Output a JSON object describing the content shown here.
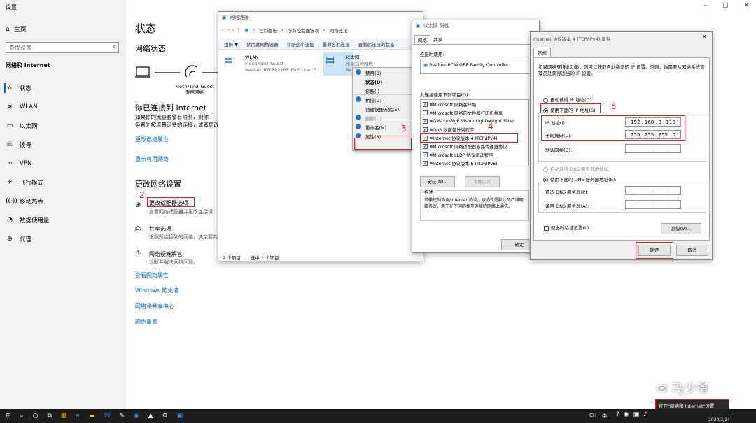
{
  "settings": {
    "title": "设置",
    "home": "主页",
    "search_placeholder": "查找设置",
    "section": "网络和 Internet",
    "nav": [
      {
        "icon": "⌂",
        "label": "状态"
      },
      {
        "icon": "≋",
        "label": "WLAN"
      },
      {
        "icon": "▭",
        "label": "以太网"
      },
      {
        "icon": "☏",
        "label": "拨号"
      },
      {
        "icon": "∞",
        "label": "VPN"
      },
      {
        "icon": "✈",
        "label": "飞行模式"
      },
      {
        "icon": "((·))",
        "label": "移动热点"
      },
      {
        "icon": "◔",
        "label": "数据使用量"
      },
      {
        "icon": "⊕",
        "label": "代理"
      }
    ],
    "page_title": "状态",
    "network_status": "网络状态",
    "network_name": "MechMind_Guest",
    "network_type": "专用网络",
    "connected_title": "你已连接到 Internet",
    "connected_desc1": "如果你的流量套餐有限制，则你",
    "connected_desc2": "务置为按流量计费的连接，或者更改其他属性。",
    "change_props": "更改连接属性",
    "show_networks": "显示可用网络",
    "change_settings": "更改网络设置",
    "adapter_opts": "更改适配器选项",
    "adapter_desc": "查看网络适配器并更改连接设",
    "sharing": "共享选项",
    "sharing_desc": "根据所连接到的网络，决定要共",
    "troubleshoot": "网络疑难解答",
    "troubleshoot_desc": "诊断并解决网络问题。",
    "link1": "查看网络属性",
    "link2": "Windows 防火墙",
    "link3": "网络和共享中心",
    "link4": "网络重置"
  },
  "netconn": {
    "title": "网络连接",
    "addr": [
      "控制面板",
      "所有控制面板项",
      "网络连接"
    ],
    "toolbar": [
      "组织 ▼",
      "禁用此网络设备",
      "诊断这个连接",
      "重命名此连接",
      "查看此连接的状态"
    ],
    "wlan_name": "WLAN",
    "wlan_net": "MechMind_Guest",
    "wlan_adapter": "Realtek RTL8822BE 802.11ac P...",
    "eth_name": "以太网",
    "eth_status": "未识别的网络",
    "eth_short": "Re",
    "status": "2 个项目",
    "selected": "选中 1 个项目"
  },
  "context": [
    "禁用(B)",
    "状态(U)",
    "诊断(I)",
    "桥接(G)",
    "创建快捷方式(S)",
    "删除(D)",
    "重命名(M)",
    "属性(R)"
  ],
  "ethprops": {
    "title": "以太网 属性",
    "tabs": [
      "网络",
      "共享"
    ],
    "connect_using": "连接时使用:",
    "adapter": "Realtek PCIe GBE Family Controller",
    "items_label": "此连接使用下列项目(O):",
    "items": [
      "Microsoft 网络客户端",
      "Microsoft 网络的文件和打印机共享",
      "Galaxy GigE Vision LightWeight Filter",
      "QoS 数据包计划程序",
      "Internet 协议版本 4 (TCP/IPv4)",
      "Microsoft 网络适配器多路传送器协议",
      "Microsoft LLDP 协议驱动程序",
      "Internet 协议版本 6 (TCP/IPv6)"
    ],
    "install": "安装(N)...",
    "uninstall": "卸载(U)",
    "desc_label": "描述",
    "desc": "传输控制协议/Internet 协议。该协议是默认的广域网络协议，用于在不同的相互连接的网络上通信。",
    "ok": "确定"
  },
  "ipv4": {
    "title": "Internet 协议版本 4 (TCP/IPv4) 属性",
    "tab": "常规",
    "intro": "如果网络支持此功能，则可以获取自动指派的 IP 设置。否则，你需要从网络系统管理员处获得适当的 IP 设置。",
    "auto_ip": "自动获得 IP 地址(O)",
    "manual_ip": "使用下面的 IP 地址(S):",
    "ip_label": "IP 地址(I):",
    "ip": [
      "192",
      "168",
      "3",
      "110"
    ],
    "mask_label": "子网掩码(U):",
    "mask": [
      "255",
      "255",
      "255",
      "0"
    ],
    "gw_label": "默认网关(D):",
    "auto_dns": "自动获得 DNS 服务器地址(B)",
    "manual_dns": "使用下面的 DNS 服务器地址(E):",
    "dns1": "首选 DNS 服务器(P):",
    "dns2": "备用 DNS 服务器(A):",
    "validate": "退出时验证设置(L)",
    "advanced": "高级(V)...",
    "ok": "确定",
    "cancel": "取消"
  },
  "annotations": [
    "2",
    "3",
    "4",
    "5"
  ],
  "tooltip": "打开\"网络和 Internet\"设置",
  "watermark": "马少爷",
  "clock": "2020/2/14",
  "taskbar_lang": "中"
}
